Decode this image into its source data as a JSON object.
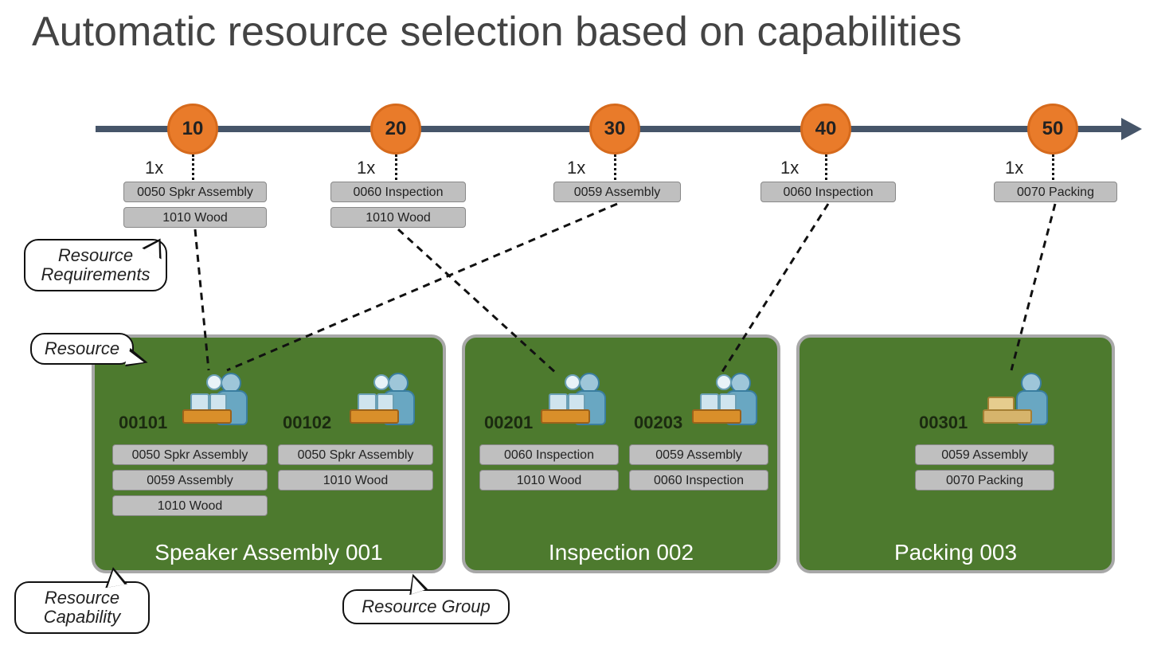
{
  "title": "Automatic resource selection based on capabilities",
  "multiplier": "1x",
  "steps": [
    {
      "num": "10",
      "reqs": [
        "0050 Spkr Assembly",
        "1010 Wood"
      ]
    },
    {
      "num": "20",
      "reqs": [
        "0060 Inspection",
        "1010 Wood"
      ]
    },
    {
      "num": "30",
      "reqs": [
        "0059 Assembly"
      ]
    },
    {
      "num": "40",
      "reqs": [
        "0060 Inspection"
      ]
    },
    {
      "num": "50",
      "reqs": [
        "0070 Packing"
      ]
    }
  ],
  "callouts": {
    "requirements": "Resource\nRequirements",
    "resource": "Resource",
    "capability": "Resource\nCapability",
    "group": "Resource Group"
  },
  "groups": [
    {
      "title": "Speaker Assembly 001",
      "resources": [
        {
          "id": "00101",
          "type": "asm",
          "caps": [
            "0050 Spkr Assembly",
            "0059 Assembly",
            "1010 Wood"
          ]
        },
        {
          "id": "00102",
          "type": "asm",
          "caps": [
            "0050 Spkr Assembly",
            "1010 Wood"
          ]
        }
      ]
    },
    {
      "title": "Inspection 002",
      "resources": [
        {
          "id": "00201",
          "type": "insp",
          "caps": [
            "0060 Inspection",
            "1010 Wood"
          ]
        },
        {
          "id": "00203",
          "type": "insp",
          "caps": [
            "0059 Assembly",
            "0060 Inspection"
          ]
        }
      ]
    },
    {
      "title": "Packing 003",
      "resources": [
        {
          "id": "00301",
          "type": "pack",
          "caps": [
            "0059 Assembly",
            "0070 Packing"
          ]
        }
      ]
    }
  ],
  "colors": {
    "accent": "#E97B2A",
    "arrow": "#465569",
    "group": "#4D7A2E",
    "chip": "#bfbfbf"
  }
}
